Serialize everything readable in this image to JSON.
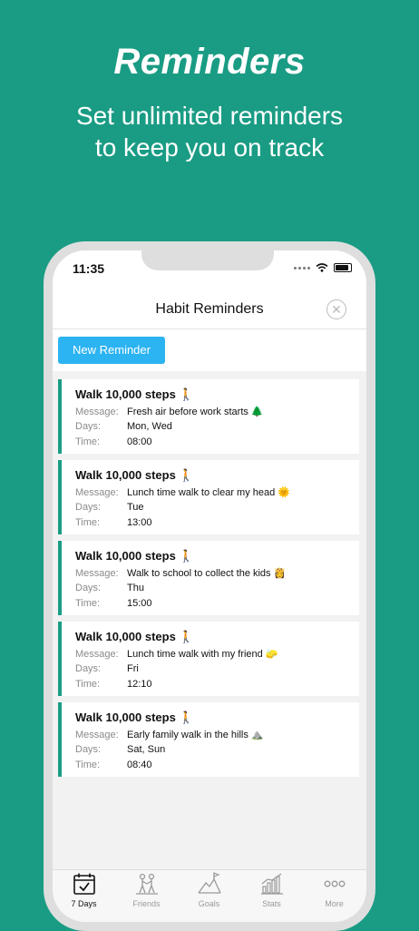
{
  "promo": {
    "title": "Reminders",
    "subtitle_line1": "Set unlimited reminders",
    "subtitle_line2": "to keep you on track",
    "background_color": "#1a9c84"
  },
  "status_bar": {
    "time": "11:35"
  },
  "nav": {
    "title": "Habit Reminders",
    "close_icon": "close-circle-icon"
  },
  "toolbar": {
    "new_reminder_label": "New Reminder",
    "button_color": "#2cb3f1"
  },
  "labels": {
    "message": "Message:",
    "days": "Days:",
    "time": "Time:"
  },
  "reminders": [
    {
      "title": "Walk 10,000 steps 🚶",
      "message": "Fresh air before work starts 🌲",
      "days": "Mon, Wed",
      "time": "08:00"
    },
    {
      "title": "Walk 10,000 steps 🚶",
      "message": "Lunch time walk to clear my head 🌞",
      "days": "Tue",
      "time": "13:00"
    },
    {
      "title": "Walk 10,000 steps 🚶",
      "message": "Walk to school to collect the kids 👸",
      "days": "Thu",
      "time": "15:00"
    },
    {
      "title": "Walk 10,000 steps 🚶",
      "message": "Lunch time walk with my friend 🧽",
      "days": "Fri",
      "time": "12:10"
    },
    {
      "title": "Walk 10,000 steps 🚶",
      "message": "Early family walk in the hills ⛰️",
      "days": "Sat, Sun",
      "time": "08:40"
    }
  ],
  "tabs": [
    {
      "label": "7 Days",
      "icon": "calendar-check-icon",
      "active": true
    },
    {
      "label": "Friends",
      "icon": "friends-icon",
      "active": false
    },
    {
      "label": "Goals",
      "icon": "mountain-flag-icon",
      "active": false
    },
    {
      "label": "Stats",
      "icon": "bar-chart-icon",
      "active": false
    },
    {
      "label": "More",
      "icon": "more-dots-icon",
      "active": false
    }
  ]
}
